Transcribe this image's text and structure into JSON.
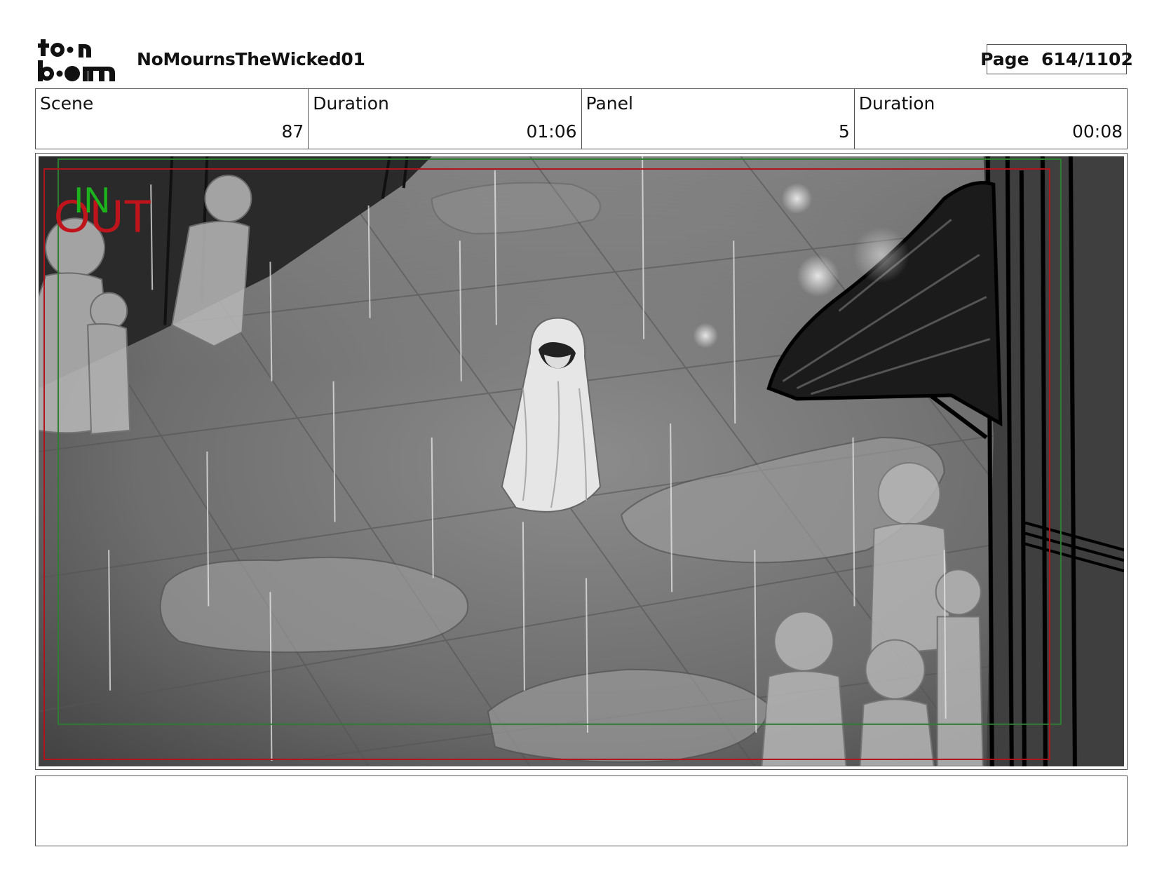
{
  "header": {
    "logo_top": "toon",
    "logo_bottom": "boom",
    "title": "NoMournsTheWicked01",
    "page_label": "Page",
    "page_value": "614/1102"
  },
  "info": {
    "scene_label": "Scene",
    "scene_value": "87",
    "scene_duration_label": "Duration",
    "scene_duration_value": "01:06",
    "panel_label": "Panel",
    "panel_value": "5",
    "panel_duration_label": "Duration",
    "panel_duration_value": "00:08"
  },
  "panel": {
    "in_marker": "IN",
    "out_marker": "OUT",
    "in_color": "#1db31d",
    "out_color": "#c0141c"
  },
  "notes": {
    "text": ""
  }
}
